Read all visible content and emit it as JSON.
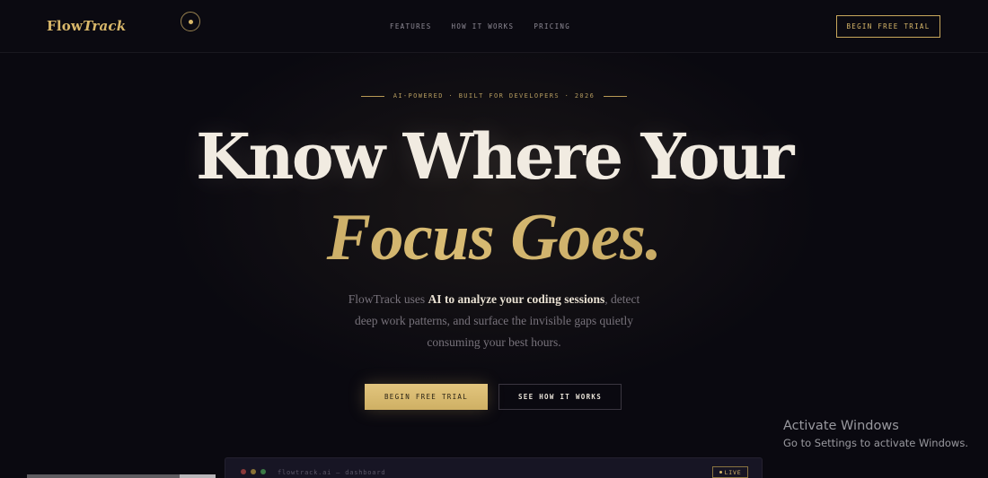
{
  "nav": {
    "logo_main": "Flow",
    "logo_italic": "Track",
    "links": [
      "FEATURES",
      "HOW IT WORKS",
      "PRICING"
    ],
    "cta_label": "BEGIN FREE TRIAL"
  },
  "hero": {
    "eyebrow": "AI-POWERED · BUILT FOR DEVELOPERS · 2026",
    "headline_line1": "Know Where Your",
    "headline_line2": "Focus Goes.",
    "subtext_pre": "FlowTrack uses ",
    "subtext_emph": "AI to analyze your coding sessions",
    "subtext_post": ", detect deep work patterns, and surface the invisible gaps quietly consuming your best hours.",
    "primary_button": "BEGIN FREE TRIAL",
    "secondary_button": "SEE HOW IT WORKS"
  },
  "preview": {
    "window_title": "flowtrack.ai — dashboard",
    "live_badge": "LIVE"
  },
  "watermark": {
    "title": "Activate Windows",
    "subtitle": "Go to Settings to activate Windows."
  },
  "colors": {
    "accent_gold": "#d9b86a",
    "background": "#0a0910",
    "headline": "#f1ebe1"
  }
}
